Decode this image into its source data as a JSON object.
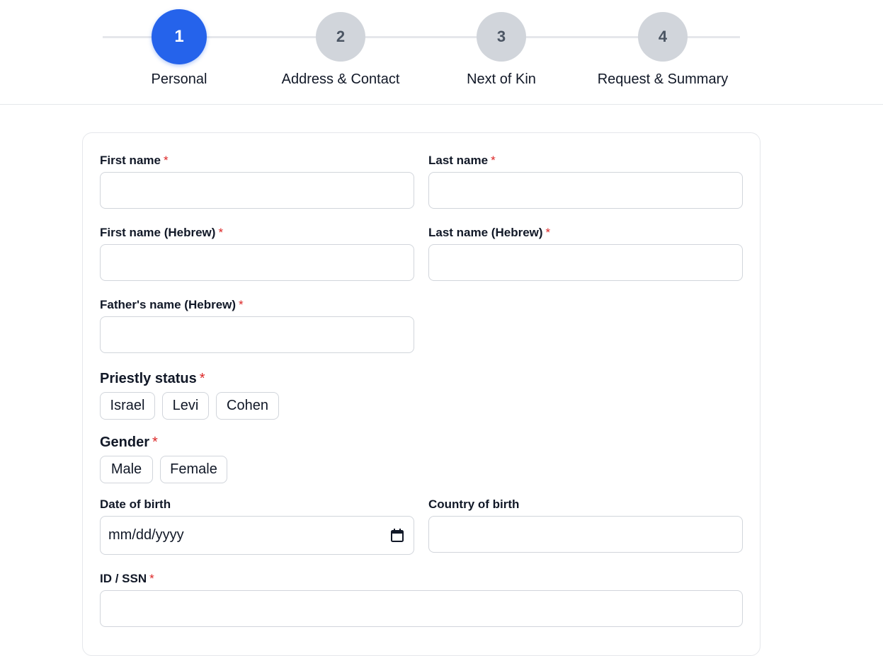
{
  "stepper": {
    "steps": [
      {
        "number": "1",
        "label": "Personal",
        "active": true
      },
      {
        "number": "2",
        "label": "Address & Contact",
        "active": false
      },
      {
        "number": "3",
        "label": "Next of Kin",
        "active": false
      },
      {
        "number": "4",
        "label": "Request & Summary",
        "active": false
      }
    ]
  },
  "form": {
    "required_mark": "*",
    "first_name": {
      "label": "First name",
      "value": ""
    },
    "last_name": {
      "label": "Last name",
      "value": ""
    },
    "first_name_hebrew": {
      "label": "First name (Hebrew)",
      "value": ""
    },
    "last_name_hebrew": {
      "label": "Last name (Hebrew)",
      "value": ""
    },
    "fathers_name_hebrew": {
      "label": "Father's name (Hebrew)",
      "value": ""
    },
    "priestly_status": {
      "label": "Priestly status",
      "options": [
        "Israel",
        "Levi",
        "Cohen"
      ]
    },
    "gender": {
      "label": "Gender",
      "options": [
        "Male",
        "Female"
      ]
    },
    "date_of_birth": {
      "label": "Date of birth",
      "placeholder": "mm/dd/yyyy"
    },
    "country_of_birth": {
      "label": "Country of birth",
      "value": ""
    },
    "id_ssn": {
      "label": "ID / SSN",
      "value": ""
    }
  },
  "colors": {
    "accent": "#2563eb",
    "required": "#dc2626",
    "inactive_step": "#d1d5db",
    "border": "#d1d5db"
  },
  "icons": {
    "calendar": "calendar-icon"
  }
}
